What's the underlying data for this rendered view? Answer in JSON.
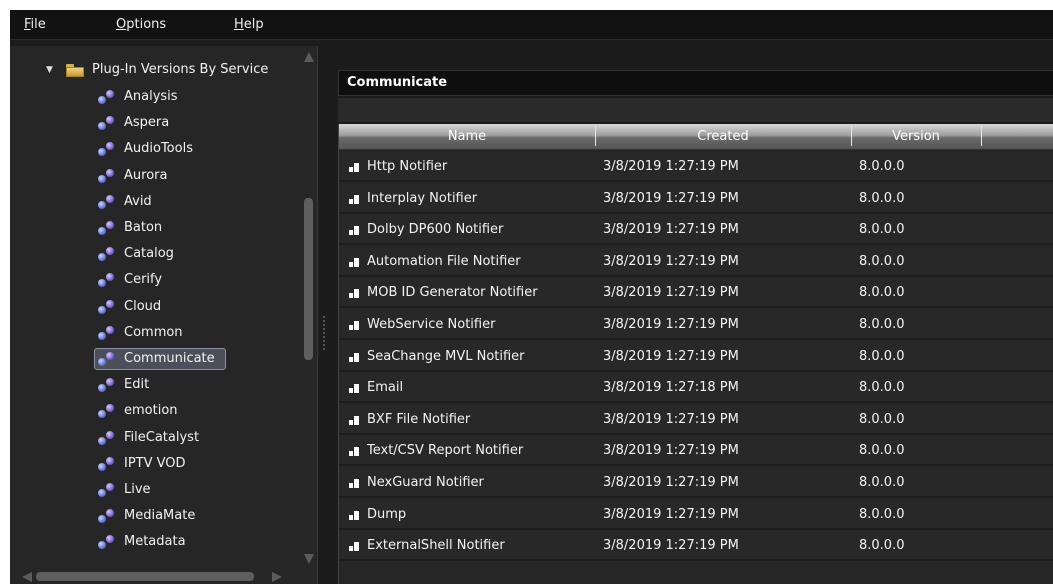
{
  "menu": {
    "file": "File",
    "options": "Options",
    "help": "Help"
  },
  "tree": {
    "root_label": "Plug-In Versions By Service",
    "items": [
      {
        "label": "Analysis"
      },
      {
        "label": "Aspera"
      },
      {
        "label": "AudioTools"
      },
      {
        "label": "Aurora"
      },
      {
        "label": "Avid"
      },
      {
        "label": "Baton"
      },
      {
        "label": "Catalog"
      },
      {
        "label": "Cerify"
      },
      {
        "label": "Cloud"
      },
      {
        "label": "Common"
      },
      {
        "label": "Communicate",
        "selected": true
      },
      {
        "label": "Edit"
      },
      {
        "label": "emotion"
      },
      {
        "label": "FileCatalyst"
      },
      {
        "label": "IPTV VOD"
      },
      {
        "label": "Live"
      },
      {
        "label": "MediaMate"
      },
      {
        "label": "Metadata"
      }
    ]
  },
  "panel": {
    "title": "Communicate"
  },
  "grid": {
    "columns": [
      "Name",
      "Created",
      "Version"
    ],
    "rows": [
      {
        "name": "Http Notifier",
        "created": "3/8/2019 1:27:19 PM",
        "version": "8.0.0.0"
      },
      {
        "name": "Interplay Notifier",
        "created": "3/8/2019 1:27:19 PM",
        "version": "8.0.0.0"
      },
      {
        "name": "Dolby DP600 Notifier",
        "created": "3/8/2019 1:27:19 PM",
        "version": "8.0.0.0"
      },
      {
        "name": "Automation File Notifier",
        "created": "3/8/2019 1:27:19 PM",
        "version": "8.0.0.0"
      },
      {
        "name": "MOB ID Generator Notifier",
        "created": "3/8/2019 1:27:19 PM",
        "version": "8.0.0.0"
      },
      {
        "name": "WebService Notifier",
        "created": "3/8/2019 1:27:19 PM",
        "version": "8.0.0.0"
      },
      {
        "name": "SeaChange MVL Notifier",
        "created": "3/8/2019 1:27:19 PM",
        "version": "8.0.0.0"
      },
      {
        "name": "Email",
        "created": "3/8/2019 1:27:18 PM",
        "version": "8.0.0.0"
      },
      {
        "name": "BXF File Notifier",
        "created": "3/8/2019 1:27:19 PM",
        "version": "8.0.0.0"
      },
      {
        "name": "Text/CSV Report Notifier",
        "created": "3/8/2019 1:27:19 PM",
        "version": "8.0.0.0"
      },
      {
        "name": "NexGuard Notifier",
        "created": "3/8/2019 1:27:19 PM",
        "version": "8.0.0.0"
      },
      {
        "name": "Dump",
        "created": "3/8/2019 1:27:19 PM",
        "version": "8.0.0.0"
      },
      {
        "name": "ExternalShell Notifier",
        "created": "3/8/2019 1:27:19 PM",
        "version": "8.0.0.0"
      }
    ]
  },
  "icons": {
    "folder": "folder-icon",
    "plugin": "plugin-icon",
    "row": "notifier-icon"
  }
}
